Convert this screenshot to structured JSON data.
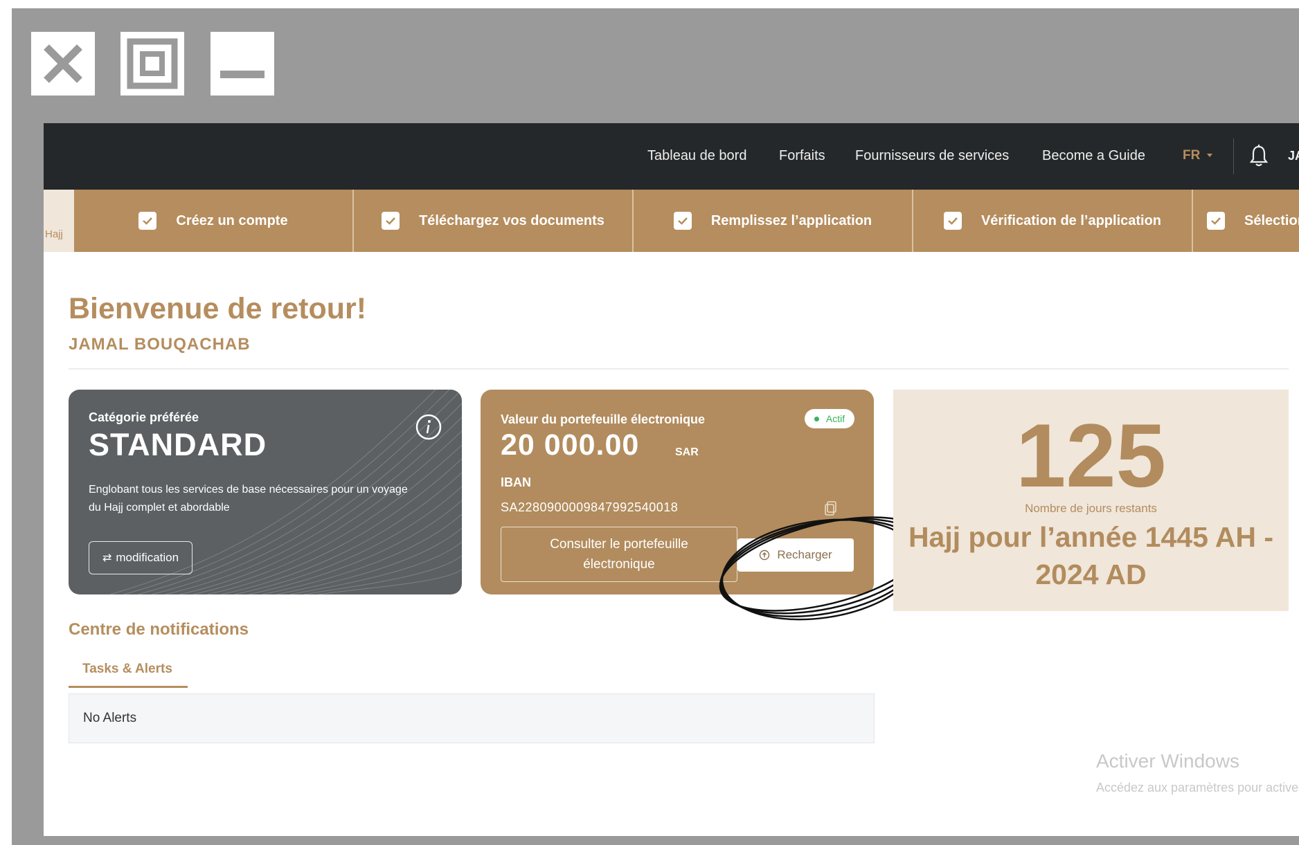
{
  "window_controls": {
    "close_icon": "close-icon",
    "maximize_icon": "maximize-icon",
    "minimize_icon": "minimize-icon"
  },
  "nav": {
    "items": [
      "Tableau de bord",
      "Forfaits",
      "Fournisseurs de services",
      "Become a Guide"
    ],
    "lang": "FR",
    "user_initials": "JAM"
  },
  "steps": {
    "first_label": "Hajj",
    "items": [
      "Créez un compte",
      "Téléchargez vos documents",
      "Remplissez l’application",
      "Vérification de l’application",
      "Sélectionnez"
    ]
  },
  "welcome": {
    "title": "Bienvenue de retour!",
    "name": "JAMAL BOUQACHAB"
  },
  "category_card": {
    "label": "Catégorie préférée",
    "title": "STANDARD",
    "description": "Englobant tous les services de base nécessaires pour un voyage du Hajj complet et abordable",
    "button": "modification"
  },
  "wallet_card": {
    "label": "Valeur du portefeuille électronique",
    "status": "Actif",
    "amount": "20 000.00",
    "currency": "SAR",
    "iban_label": "IBAN",
    "iban": "SA2280900009847992540018",
    "consult_button": "Consulter le portefeuille électronique",
    "recharge_button": "Recharger"
  },
  "days_card": {
    "days": "125",
    "label": "Nombre de jours restants",
    "year_text": "Hajj pour l’année 1445 AH - 2024 AD"
  },
  "notifications": {
    "title": "Centre de notifications",
    "tab": "Tasks & Alerts",
    "empty": "No Alerts"
  },
  "windows_watermark": {
    "title": "Activer Windows",
    "subtitle": "Accédez aux paramètres pour activer"
  },
  "colors": {
    "gold": "#b58d5e",
    "dark_nav": "#25282a",
    "grey_card": "#5c6062",
    "beige": "#f0e6da",
    "frame": "#9a9a9b"
  }
}
